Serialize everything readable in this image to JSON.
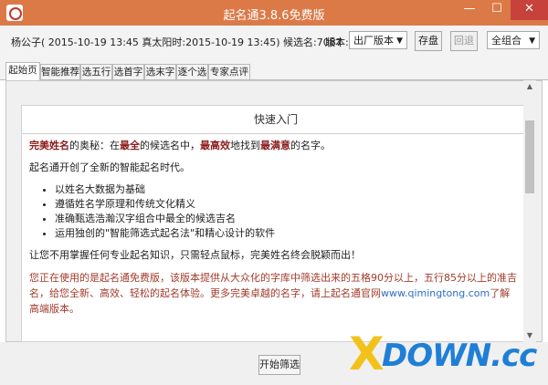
{
  "window": {
    "title": "起名通3.8.6免费版",
    "minimize_label": "—",
    "maximize_label": "☐",
    "close_label": "✕"
  },
  "info": {
    "text": "杨公子( 2015-10-19 13:45 真太阳时:2015-10-19 13:45) 候选名:7087",
    "version_label": "版本:",
    "version_value": "出厂版本",
    "save_label": "存盘",
    "back_label": "回退",
    "combo_value": "全组合"
  },
  "tabs": [
    {
      "label": "起始页"
    },
    {
      "label": "智能推荐"
    },
    {
      "label": "选五行"
    },
    {
      "label": "选首字"
    },
    {
      "label": "选末字"
    },
    {
      "label": "逐个选"
    },
    {
      "label": "专家点评"
    }
  ],
  "doc": {
    "header": "快速入门",
    "intro_prefix": "完美姓名",
    "intro_1": "的奥秘：在",
    "intro_2": "最全",
    "intro_3": "的候选名中，",
    "intro_4": "最高效",
    "intro_5": "地找到",
    "intro_6": "最满意",
    "intro_7": "的名字。",
    "line2": "起名通开创了全新的智能起名时代。",
    "features": [
      "以姓名大数据为基础",
      "遵循姓名学原理和传统文化精义",
      "准确甄选浩瀚汉字组合中最全的候选吉名",
      "运用独创的\"智能筛选式起名法\"和精心设计的软件"
    ],
    "line3": "让您不用掌握任何专业起名知识，只需轻点鼠标，完美姓名终会脱颖而出！",
    "notice_1": "您正在使用的是起名通免费版，该版本提供从大众化的字库中筛选出来的五格90分以上，五行85分以上的准吉名，给您全新、高效、轻松的起名体验。更多完美卓越的名字，请上起名通官网",
    "notice_link": "www.qimingtong.com",
    "notice_2": "了解高端版本。"
  },
  "bottom": {
    "start_label": "开始筛选"
  },
  "watermark": {
    "mark": "X",
    "text": "DOWN.cc"
  },
  "colors": {
    "titlebar": "#dc7a47",
    "emphasis": "#8b1c1c",
    "notice": "#a23b2c",
    "link": "#2a6fc0"
  }
}
